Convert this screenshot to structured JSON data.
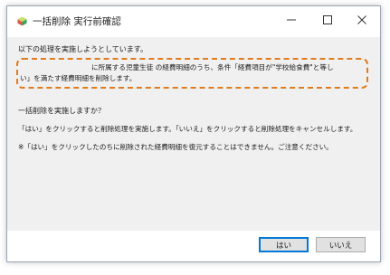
{
  "window": {
    "title": "一括削除 実行前確認"
  },
  "message": {
    "line1": "以下の処理を実施しようとしています。",
    "highlight_line1": "に所属する児童生徒 の経費明細のうち、条件「経費項目が\"学校給食費\"と等し",
    "highlight_line2": "い」を満たす経費明細を削除します。",
    "question": "一括削除を実施しますか？",
    "instruction": "「はい」をクリックすると削除処理を実施します。「いいえ」をクリックすると削除処理をキャンセルします。",
    "warning": "※「はい」をクリックしたのちに削除された経費明細を復元することはできません。ご注意ください。"
  },
  "buttons": {
    "yes": "はい",
    "no": "いいえ"
  },
  "colors": {
    "highlight_border": "#e07b1f",
    "default_button_border": "#0078d7",
    "content_bg": "#f0f0f0"
  },
  "icons": {
    "app": "green-cube-icon",
    "minimize": "minimize-icon",
    "maximize": "maximize-icon",
    "close": "close-icon"
  }
}
